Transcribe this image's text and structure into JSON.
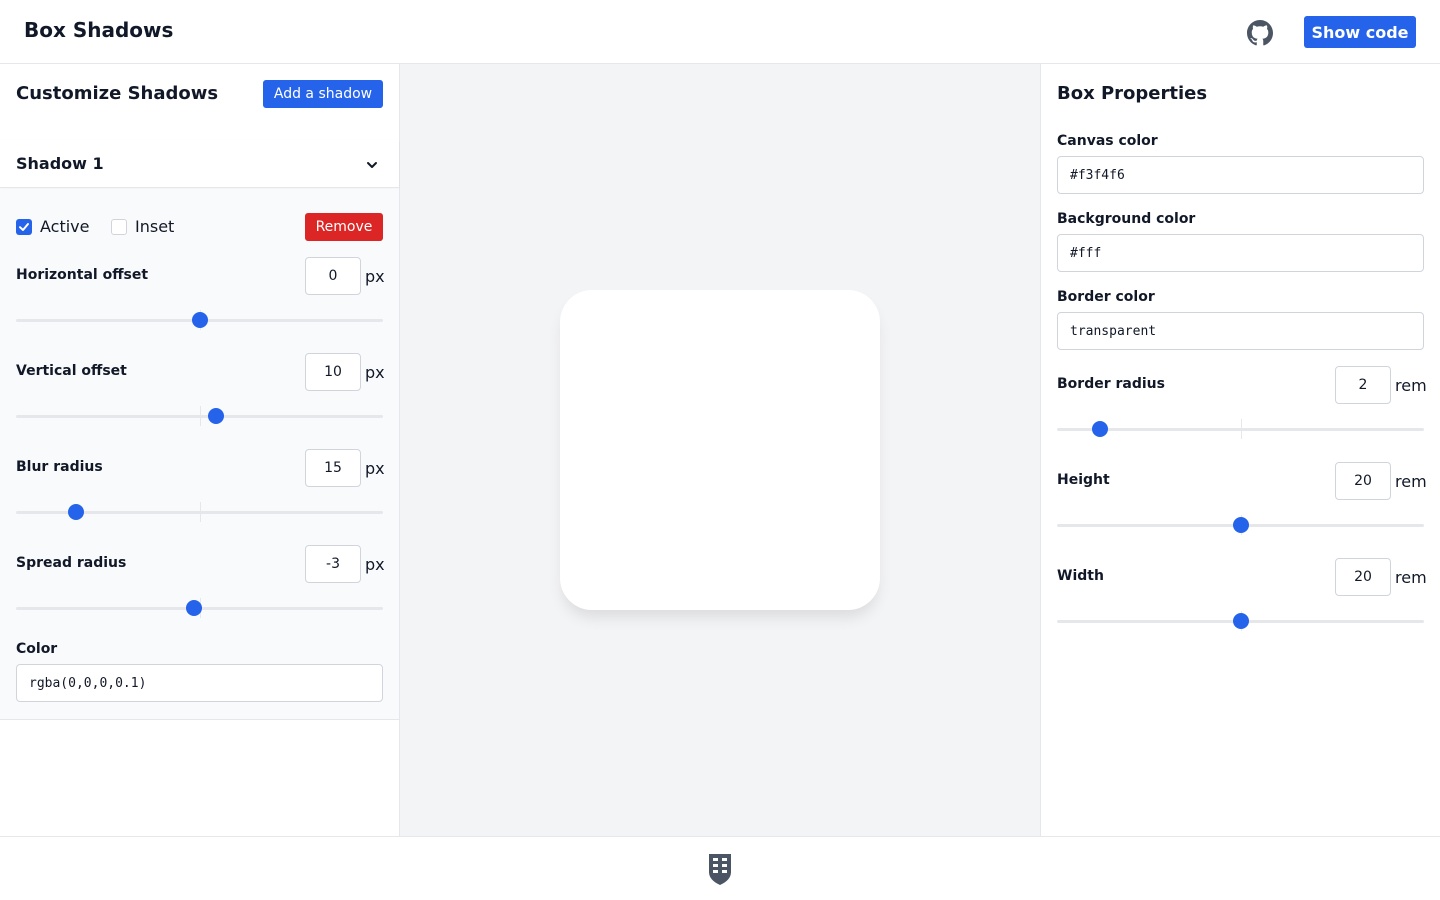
{
  "header": {
    "title": "Box Shadows",
    "github_icon": "github-icon",
    "show_code_label": "Show code"
  },
  "left_panel": {
    "title": "Customize Shadows",
    "add_shadow_label": "Add a shadow",
    "shadow": {
      "name": "Shadow 1",
      "active_label": "Active",
      "active_checked": true,
      "inset_label": "Inset",
      "inset_checked": false,
      "remove_label": "Remove",
      "horizontal": {
        "label": "Horizontal offset",
        "value": "0",
        "unit": "px",
        "slider_fraction": 0.5
      },
      "vertical": {
        "label": "Vertical offset",
        "value": "10",
        "unit": "px",
        "slider_fraction": 0.546
      },
      "blur": {
        "label": "Blur radius",
        "value": "15",
        "unit": "px",
        "slider_fraction": 0.164
      },
      "spread": {
        "label": "Spread radius",
        "value": "-3",
        "unit": "px",
        "slider_fraction": 0.486
      },
      "color": {
        "label": "Color",
        "value": "rgba(0,0,0,0.1)"
      }
    }
  },
  "right_panel": {
    "title": "Box Properties",
    "canvas_color": {
      "label": "Canvas color",
      "value": "#f3f4f6"
    },
    "background_color": {
      "label": "Background color",
      "value": "#fff"
    },
    "border_color": {
      "label": "Border color",
      "value": "transparent"
    },
    "border_radius": {
      "label": "Border radius",
      "value": "2",
      "unit": "rem",
      "slider_fraction": 0.117
    },
    "height": {
      "label": "Height",
      "value": "20",
      "unit": "rem",
      "slider_fraction": 0.5
    },
    "width": {
      "label": "Width",
      "value": "20",
      "unit": "rem",
      "slider_fraction": 0.5
    }
  },
  "footer": {
    "logo_icon": "shield-logo-icon"
  },
  "colors": {
    "accent": "#2563eb",
    "danger": "#dc2626",
    "canvas": "#f3f4f6",
    "border": "#e5e7eb"
  }
}
